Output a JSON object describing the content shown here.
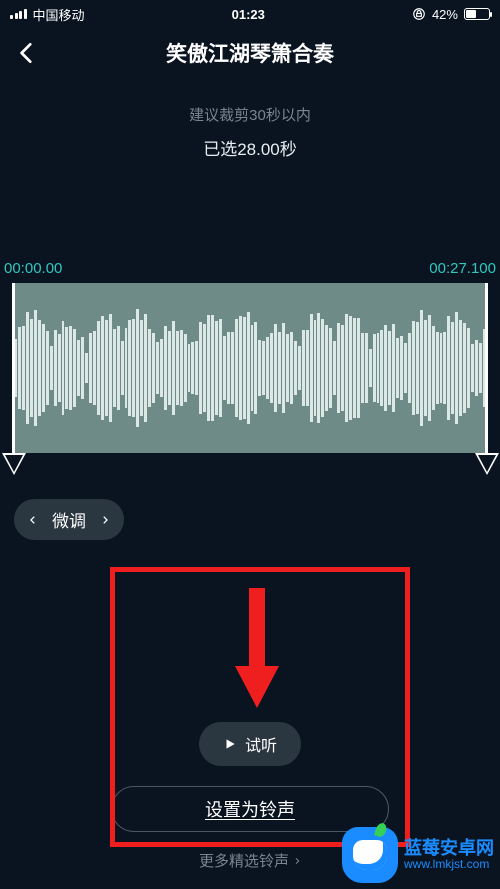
{
  "status": {
    "carrier": "中国移动",
    "time": "01:23",
    "battery_pct": "42%",
    "lock_icon": "orientation-lock"
  },
  "nav": {
    "title": "笑傲江湖琴箫合奏"
  },
  "editor": {
    "hint": "建议裁剪30秒以内",
    "selected_label": "已选28.00秒",
    "time_start": "00:00.00",
    "time_end": "00:27.100"
  },
  "controls": {
    "fine_tune_label": "微调",
    "preview_label": "试听",
    "set_ringtone_label": "设置为铃声",
    "more_label": "更多精选铃声"
  },
  "watermark": {
    "name": "蓝莓安卓网",
    "url": "www.lmkjst.com"
  },
  "highlight": {
    "color": "#ef1f1f"
  }
}
